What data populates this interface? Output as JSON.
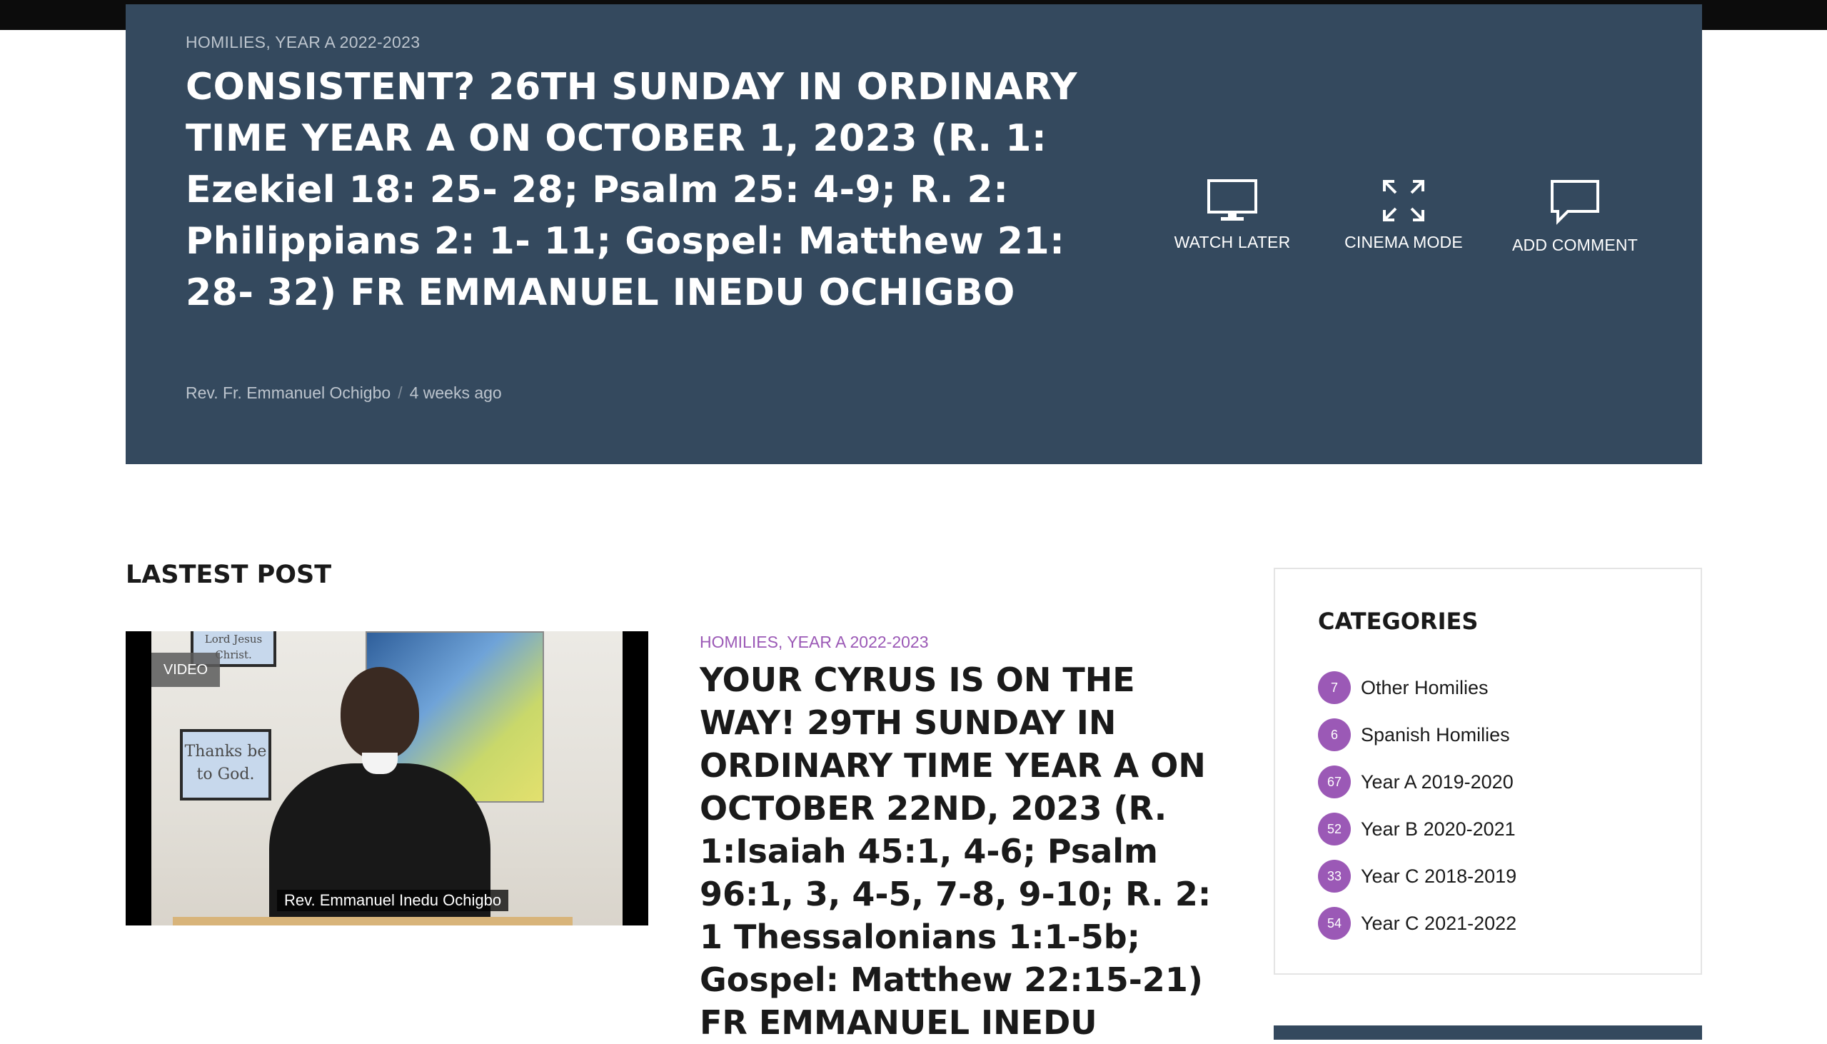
{
  "hero": {
    "category_1": "HOMILIES",
    "category_sep": ", ",
    "category_2": "YEAR A 2022-2023",
    "title": "CONSISTENT? 26TH SUNDAY IN ORDINARY TIME YEAR A ON OCTOBER 1, 2023 (R. 1: Ezekiel 18: 25- 28; Psalm 25: 4-9; R. 2: Philippians 2: 1- 11; Gospel: Matthew 21: 28- 32) FR EMMANUEL INEDU OCHIGBO",
    "author": "Rev. Fr. Emmanuel Ochigbo",
    "meta_sep": "/",
    "date": "4 weeks ago",
    "actions": {
      "watch_later": {
        "label": "WATCH LATER",
        "icon": "monitor-icon"
      },
      "cinema_mode": {
        "label": "CINEMA MODE",
        "icon": "expand-icon"
      },
      "add_comment": {
        "label": "ADD COMMENT",
        "icon": "comment-icon"
      }
    }
  },
  "latest": {
    "section_title": "LASTEST POST",
    "video_badge": "VIDEO",
    "video_caption": "Rev. Emmanuel Inedu Ochigbo",
    "frame_top_text": "Lord Jesus Christ.",
    "frame_text": "Thanks be to God.",
    "category_1": "HOMILIES",
    "category_sep": ", ",
    "category_2": "YEAR A 2022-2023",
    "title": "YOUR CYRUS IS ON THE WAY! 29TH SUNDAY IN ORDINARY TIME YEAR A ON OCTOBER 22ND, 2023 (R. 1:Isaiah  45:1, 4-6; Psalm 96:1, 3, 4-5, 7-8, 9-10; R. 2: 1 Thessalonians 1:1-5b; Gospel: Matthew  22:15-21)  FR EMMANUEL INEDU"
  },
  "sidebar": {
    "title": "CATEGORIES",
    "items": [
      {
        "count": "7",
        "label": "Other Homilies"
      },
      {
        "count": "6",
        "label": "Spanish Homilies"
      },
      {
        "count": "67",
        "label": "Year A 2019-2020"
      },
      {
        "count": "52",
        "label": "Year B 2020-2021"
      },
      {
        "count": "33",
        "label": "Year C 2018-2019"
      },
      {
        "count": "54",
        "label": "Year C 2021-2022"
      }
    ]
  },
  "colors": {
    "hero_bg": "#34495e",
    "accent": "#9b59b6",
    "topbar": "#0c0c0c"
  }
}
